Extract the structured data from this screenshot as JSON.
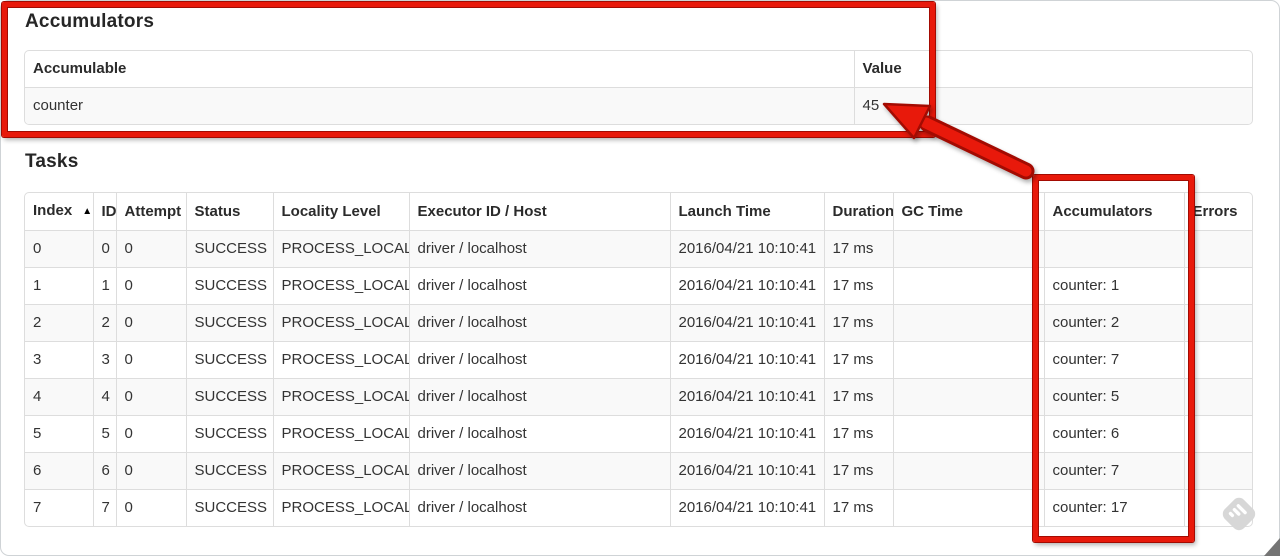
{
  "accumulators_section": {
    "heading": "Accumulators",
    "table": {
      "columns": [
        "Accumulable",
        "Value"
      ],
      "rows": [
        [
          "counter",
          "45"
        ]
      ]
    }
  },
  "tasks_section": {
    "heading": "Tasks",
    "table": {
      "columns": [
        "Index",
        "ID",
        "Attempt",
        "Status",
        "Locality Level",
        "Executor ID / Host",
        "Launch Time",
        "Duration",
        "GC Time",
        "Accumulators",
        "Errors"
      ],
      "sort_column": "Index",
      "sort_indicator": "▲",
      "rows": [
        [
          "0",
          "0",
          "0",
          "SUCCESS",
          "PROCESS_LOCAL",
          "driver / localhost",
          "2016/04/21 10:10:41",
          "17 ms",
          "",
          "",
          ""
        ],
        [
          "1",
          "1",
          "0",
          "SUCCESS",
          "PROCESS_LOCAL",
          "driver / localhost",
          "2016/04/21 10:10:41",
          "17 ms",
          "",
          "counter: 1",
          ""
        ],
        [
          "2",
          "2",
          "0",
          "SUCCESS",
          "PROCESS_LOCAL",
          "driver / localhost",
          "2016/04/21 10:10:41",
          "17 ms",
          "",
          "counter: 2",
          ""
        ],
        [
          "3",
          "3",
          "0",
          "SUCCESS",
          "PROCESS_LOCAL",
          "driver / localhost",
          "2016/04/21 10:10:41",
          "17 ms",
          "",
          "counter: 7",
          ""
        ],
        [
          "4",
          "4",
          "0",
          "SUCCESS",
          "PROCESS_LOCAL",
          "driver / localhost",
          "2016/04/21 10:10:41",
          "17 ms",
          "",
          "counter: 5",
          ""
        ],
        [
          "5",
          "5",
          "0",
          "SUCCESS",
          "PROCESS_LOCAL",
          "driver / localhost",
          "2016/04/21 10:10:41",
          "17 ms",
          "",
          "counter: 6",
          ""
        ],
        [
          "6",
          "6",
          "0",
          "SUCCESS",
          "PROCESS_LOCAL",
          "driver / localhost",
          "2016/04/21 10:10:41",
          "17 ms",
          "",
          "counter: 7",
          ""
        ],
        [
          "7",
          "7",
          "0",
          "SUCCESS",
          "PROCESS_LOCAL",
          "driver / localhost",
          "2016/04/21 10:10:41",
          "17 ms",
          "",
          "counter: 17",
          ""
        ]
      ]
    }
  },
  "annotations": {
    "accent_color": "#e8190b",
    "outline_color": "#a30b02",
    "accumulators_box_label": "highlight-accumulators-section",
    "column_box_label": "highlight-accumulators-column",
    "arrow_label": "arrow-from-accumulators-column-to-value-45"
  }
}
